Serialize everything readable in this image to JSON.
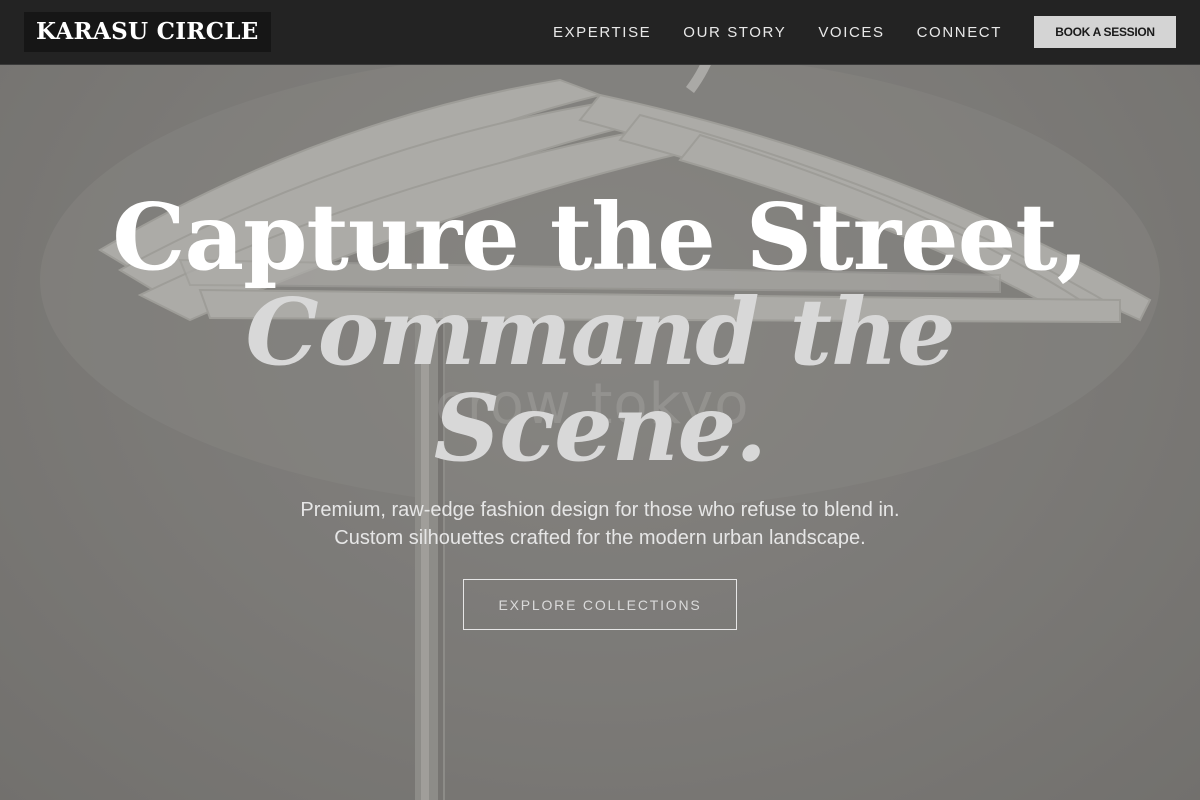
{
  "brand": {
    "logo_text": "KARASU CIRCLE"
  },
  "nav": {
    "links": [
      "EXPERTISE",
      "OUR STORY",
      "VOICES",
      "CONNECT"
    ],
    "cta_label": "BOOK A SESSION"
  },
  "hero": {
    "headline_line1": "Capture the Street,",
    "headline_line2": "Command the",
    "headline_line3": "Scene.",
    "subtitle_line1": "Premium, raw-edge fashion design for those who refuse to blend in.",
    "subtitle_line2": "Custom silhouettes crafted for the modern urban landscape.",
    "button_label": "EXPLORE COLLECTIONS",
    "background_wall_text": "crow tokyo"
  },
  "colors": {
    "nav_background": "#232323",
    "cta_background": "#d4d4d4",
    "overlay": "#8a8987",
    "headline": "#ffffff",
    "headline_italic": "#d8d8d8"
  }
}
